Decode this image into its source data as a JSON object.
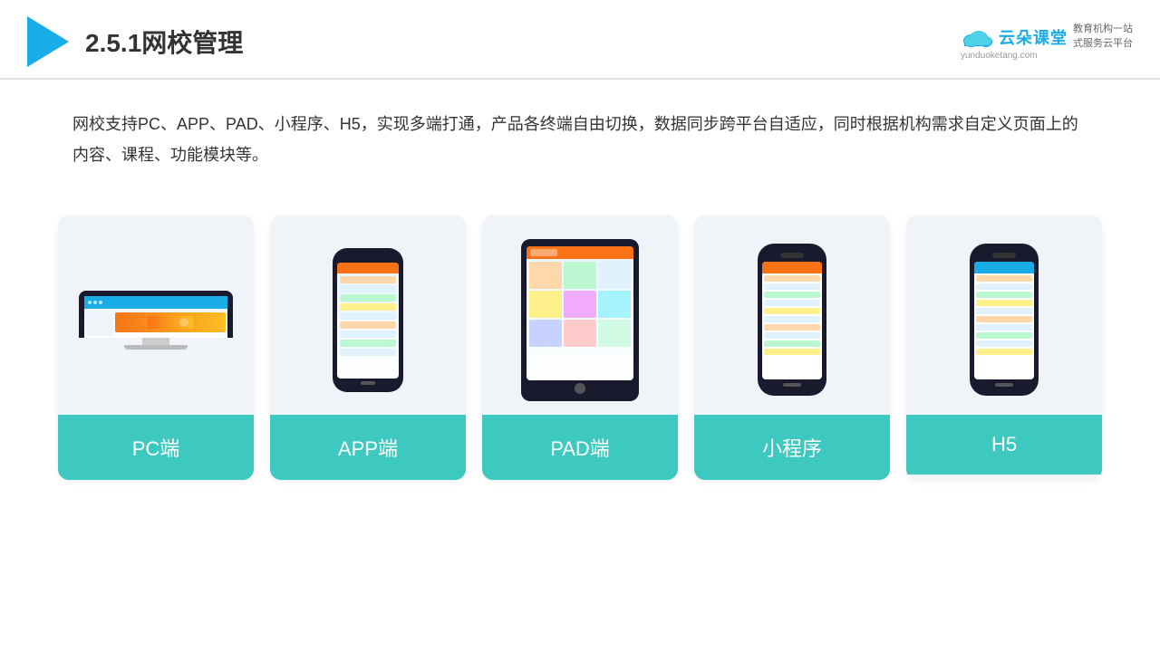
{
  "header": {
    "title": "2.5.1网校管理",
    "brand": {
      "name": "云朵课堂",
      "url": "yunduoketang.com",
      "tagline_line1": "教育机构一站",
      "tagline_line2": "式服务云平台"
    }
  },
  "description": {
    "text": "网校支持PC、APP、PAD、小程序、H5，实现多端打通，产品各终端自由切换，数据同步跨平台自适应，同时根据机构需求自定义页面上的内容、课程、功能模块等。"
  },
  "cards": [
    {
      "id": "pc",
      "label": "PC端"
    },
    {
      "id": "app",
      "label": "APP端"
    },
    {
      "id": "pad",
      "label": "PAD端"
    },
    {
      "id": "mini",
      "label": "小程序"
    },
    {
      "id": "h5",
      "label": "H5"
    }
  ],
  "accent_color": "#3dc8c0"
}
